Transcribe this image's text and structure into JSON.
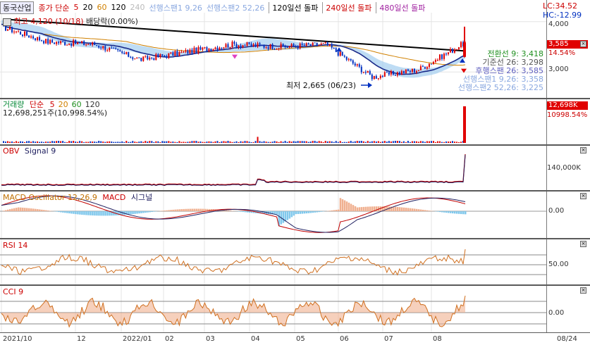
{
  "header": {
    "stock_name": "동국산업",
    "price_label": "종가 단순",
    "ma_periods": [
      "5",
      "20",
      "60",
      "120",
      "240"
    ],
    "ma_colors": [
      "#d00000",
      "#000000",
      "#d08000",
      "#000000",
      "#bbbbbb"
    ],
    "span1_label": "선행스팬1 9,26",
    "span2_label": "선행스팬2 52,26",
    "breakout_120": "120일선 돌파",
    "breakout_240": "240일선 돌파",
    "breakout_480": "480일선 돌파",
    "lc_label": "LC:34.52",
    "hc_label": "HC:-12.99",
    "high_label": "최고 4,120 (10/18)",
    "change_label": "배당락(0.00%)",
    "low_label": "최저 2,665 (06/23)"
  },
  "price_pane": {
    "y_ticks": [
      "4,000",
      "3,000"
    ],
    "current_price": "3,585",
    "current_change": "14.54%",
    "ichimoku": [
      {
        "label": "전환선 9: 3,418",
        "color": "#209020"
      },
      {
        "label": "기준선 26: 3,298",
        "color": "#555555"
      },
      {
        "label": "후행스팬 26: 3,585",
        "color": "#6060c0"
      },
      {
        "label": "선행스팬1 9,26: 3,358",
        "color": "#8aa8e0"
      },
      {
        "label": "선행스팬2 52,26: 3,225",
        "color": "#8aa8e0"
      }
    ]
  },
  "volume_pane": {
    "title": "거래량",
    "ma_label": "단순",
    "ma_periods": [
      "5",
      "20",
      "60",
      "120"
    ],
    "ma_colors": [
      "#d00000",
      "#d08000",
      "#209020",
      "#333333"
    ],
    "volume_readout": "12,698,251주(10,998.54%)",
    "badge_value": "12,698K",
    "badge_pct": "10998.54%"
  },
  "obv_pane": {
    "title": "OBV",
    "signal": "Signal 9",
    "y_tick": "140,000K"
  },
  "macd_pane": {
    "title": "MACD Oscillator 12,26,9",
    "macd": "MACD",
    "signal": "시그널",
    "y_tick": "0.00"
  },
  "rsi_pane": {
    "title": "RSI 14",
    "y_tick": "50.00"
  },
  "cci_pane": {
    "title": "CCI 9",
    "y_tick": "0.00"
  },
  "x_axis": {
    "labels": [
      "2021/10",
      "12",
      "2022/01",
      "02",
      "03",
      "04",
      "05",
      "06",
      "07",
      "08"
    ],
    "right_label": "08/24"
  },
  "colors": {
    "up": "#e00000",
    "down": "#0030c0",
    "cloud": "#a8d0f0",
    "trend": "#000000"
  },
  "chart_data": {
    "type": "line",
    "title": "동국산업",
    "x": [
      "2021/10",
      "12",
      "2022/01",
      "02",
      "03",
      "04",
      "05",
      "06",
      "07",
      "08",
      "08/24"
    ],
    "series": [
      {
        "name": "종가",
        "values": [
          3900,
          3600,
          3550,
          3250,
          3400,
          3550,
          3500,
          3550,
          2900,
          3050,
          3585
        ]
      }
    ],
    "max_price": 4120,
    "max_date": "10/18",
    "min_price": 2665,
    "min_date": "06/23",
    "last_close": 3585,
    "last_change_pct": 14.54,
    "last_volume": 12698251,
    "last_volume_pct": 10998.54,
    "ylim": [
      2500,
      4150
    ]
  }
}
